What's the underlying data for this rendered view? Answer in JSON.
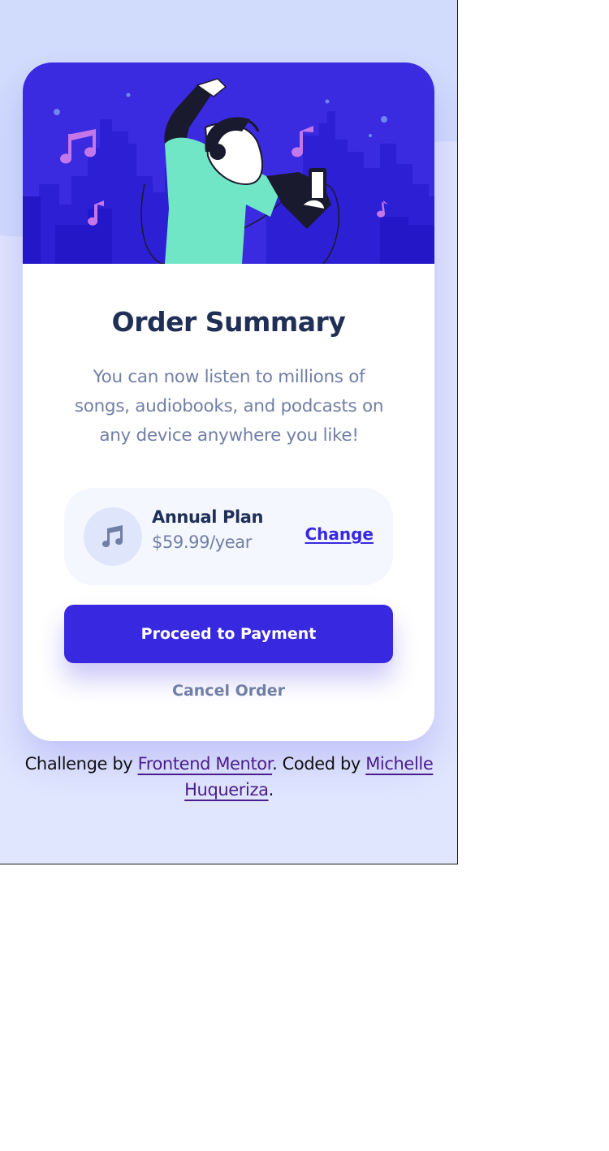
{
  "card": {
    "title": "Order Summary",
    "description": "You can now listen to millions of songs, audiobooks, and podcasts on any device anywhere you like!",
    "hero_illustration": "woman-dancing-with-headphones-illustration"
  },
  "plan": {
    "icon": "music-note-icon",
    "name": "Annual Plan",
    "price": "$59.99/year",
    "change_label": "Change"
  },
  "actions": {
    "proceed_label": "Proceed to Payment",
    "cancel_label": "Cancel Order"
  },
  "footer": {
    "prefix": "Challenge by ",
    "link1": "Frontend Mentor",
    "middle": ". Coded by ",
    "link2": "Michelle Huqueriza",
    "suffix": "."
  },
  "colors": {
    "primary": "#3829e0",
    "background": "#e0e6fe",
    "title": "#1f2f56",
    "muted": "#717fa6",
    "plan_bg": "#f5f7ff"
  }
}
